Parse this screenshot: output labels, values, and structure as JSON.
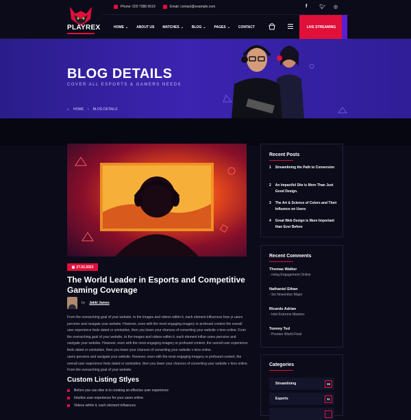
{
  "header": {
    "logo_text": "PLAYREX",
    "phone": "Phone: 020 7388 5619",
    "email": "Email: contact@example.com",
    "nav": [
      {
        "label": "HOME",
        "dropdown": true
      },
      {
        "label": "ABOUT US",
        "dropdown": false
      },
      {
        "label": "MATCHES",
        "dropdown": true
      },
      {
        "label": "BLOG",
        "dropdown": true
      },
      {
        "label": "PAGES",
        "dropdown": true
      },
      {
        "label": "CONTACT",
        "dropdown": false
      }
    ],
    "live_button": "LIVE STREAMING",
    "social_icons": [
      "facebook-icon",
      "twitter-icon",
      "instagram-icon"
    ],
    "accent": "#e0103a"
  },
  "banner": {
    "title": "BLOG DETAILS",
    "subtitle": "COVER ALL ESPORTS & GAMERS NEEDS",
    "breadcrumb_home": "HOME",
    "breadcrumb_current": "BLOG DETAILS"
  },
  "post": {
    "date": "27.02.2023",
    "title": "The World Leader in Esports and Competitive Gaming Coverage",
    "by": "by",
    "author": "Jakki James",
    "para1": "From the overarching goal of your website, to the images and videos within it, each element influences how yr users perceive and navigate your website. However, even with the most engaging imagery or profound content the overall user experience feels dated or unintuitive, then you lower your chances of converting your website v itors online. From the overarching goal of your website, to the images and videos within it, each element influe users perceive and navigate your website. However, even with the most engaging imagery or profound content, the overall user experience feels dated or unintuitive, then you lower your chances of converting your website v itors online.",
    "para2": "users perceive and navigate your website. However, even with the most engaging imagery or profound content, the overall user experience feels dated or unintuitive, then you lower your chances of converting your website v itors online. From the overarching goal of your website",
    "subheading": "Custom Listing Stlyes",
    "bullets": [
      "Before you can dive in to creating an effective user experience",
      "Intuitive user experience for your users online.",
      "Videos within it, each element influences"
    ]
  },
  "sidebar": {
    "recent_posts_title": "Recent Posts",
    "recent_posts": [
      {
        "num": "1",
        "title": "Streamlining the Path to Conversion"
      },
      {
        "num": "2",
        "title": "An Impactful Site is More Than Just Good Design."
      },
      {
        "num": "3",
        "title": "The Art & Science of Colors and Their Influence on Users"
      },
      {
        "num": "4",
        "title": "Great Web Design is More Important than Ever Before"
      }
    ],
    "recent_comments_title": "Recent Comments",
    "recent_comments": [
      {
        "name": "Thomas Walker",
        "text": "- riving Engagement Online"
      },
      {
        "name": "Nathaniel Ethan",
        "text": "- Six November Major"
      },
      {
        "name": "Ricardo Adrian",
        "text": "- Intel Extreme Masters"
      },
      {
        "name": "Tommy Ted",
        "text": "- Premier World Final"
      }
    ],
    "categories_title": "Categories",
    "categories": [
      {
        "name": "Streamlining",
        "count": "15"
      },
      {
        "name": "Esports",
        "count": "11"
      },
      {
        "name": "",
        "count": ""
      }
    ]
  }
}
